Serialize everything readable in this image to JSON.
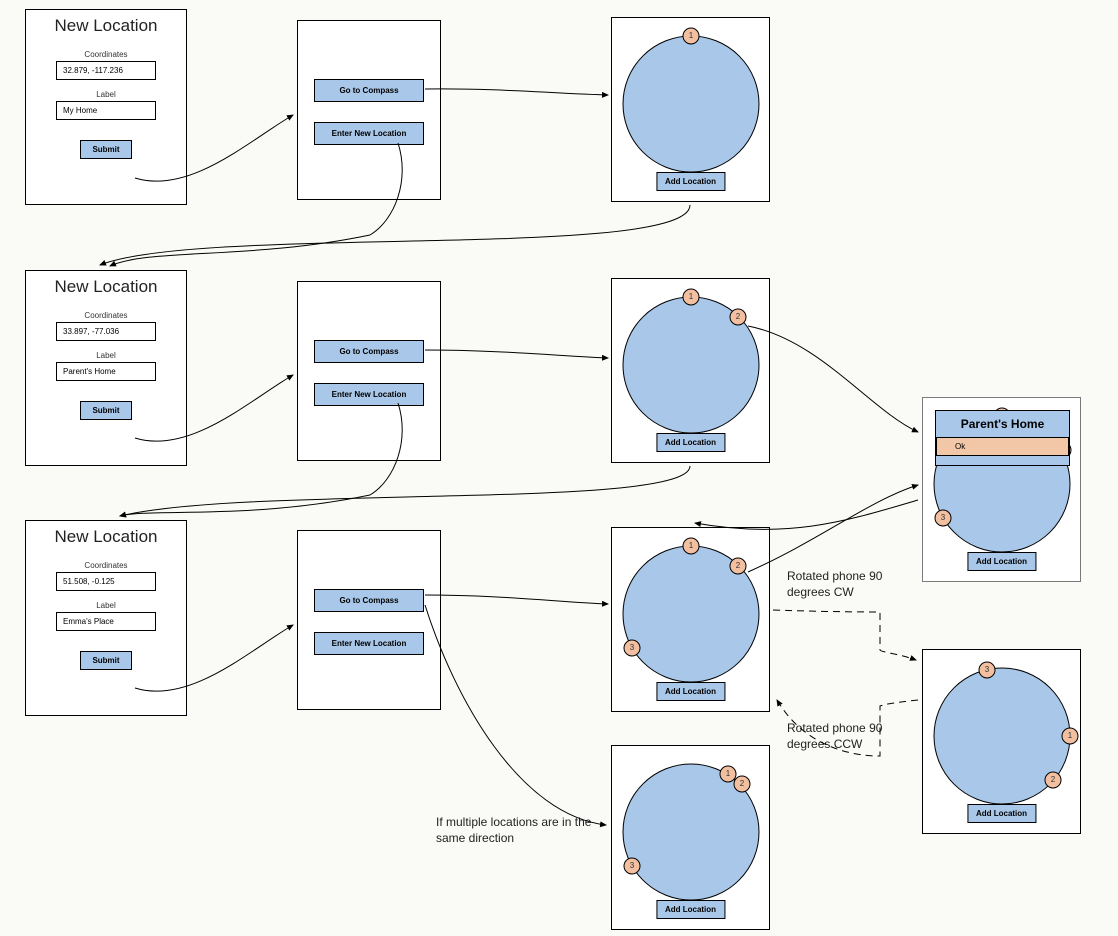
{
  "forms": {
    "a": {
      "title": "New Location",
      "coord_label": "Coordinates",
      "coord_value": "32.879, -117.236",
      "label_label": "Label",
      "label_value": "My Home",
      "submit": "Submit"
    },
    "b": {
      "title": "New Location",
      "coord_label": "Coordinates",
      "coord_value": "33.897, -77.036",
      "label_label": "Label",
      "label_value": "Parent's Home",
      "submit": "Submit"
    },
    "c": {
      "title": "New Location",
      "coord_label": "Coordinates",
      "coord_value": "51.508, -0.125",
      "label_label": "Label",
      "label_value": "Emma's Place",
      "submit": "Submit"
    }
  },
  "menu": {
    "compass": "Go to Compass",
    "enter": "Enter New Location"
  },
  "compass": {
    "add": "Add Location"
  },
  "popup": {
    "title": "Parent's Home",
    "ok": "Ok"
  },
  "markers": {
    "1": "1",
    "2": "2",
    "3": "3"
  },
  "annotations": {
    "same_dir": "If multiple locations are in the same direction",
    "cw": "Rotated phone 90 degrees CW",
    "ccw": "Rotated phone 90 degrees CCW"
  }
}
